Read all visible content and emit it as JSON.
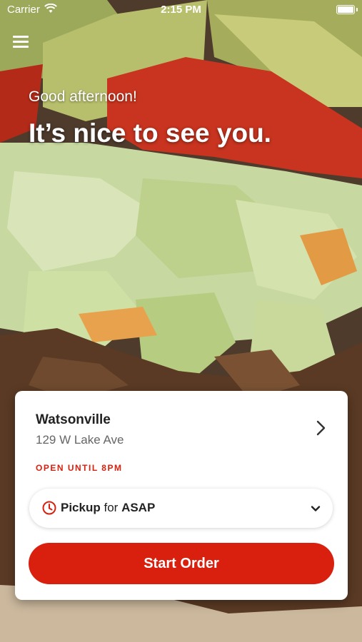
{
  "status_bar": {
    "carrier": "Carrier",
    "time": "2:15 PM",
    "wifi_icon": "wifi-icon",
    "battery_icon": "battery-icon"
  },
  "header": {
    "menu_icon": "hamburger-menu-icon"
  },
  "hero": {
    "greeting": "Good afternoon!",
    "headline": "It’s nice to see you."
  },
  "location_card": {
    "name": "Watsonville",
    "address": "129 W Lake Ave",
    "status": "OPEN UNTIL 8PM",
    "chevron_icon": "chevron-right-icon",
    "order_mode": {
      "icon": "clock-icon",
      "mode": "Pickup",
      "connector": "for",
      "time": "ASAP",
      "dropdown_icon": "chevron-down-icon"
    },
    "cta_label": "Start Order"
  },
  "colors": {
    "brand_red": "#d9200f",
    "card_bg": "#ffffff",
    "text_dark": "#222222",
    "text_muted": "#666666"
  }
}
